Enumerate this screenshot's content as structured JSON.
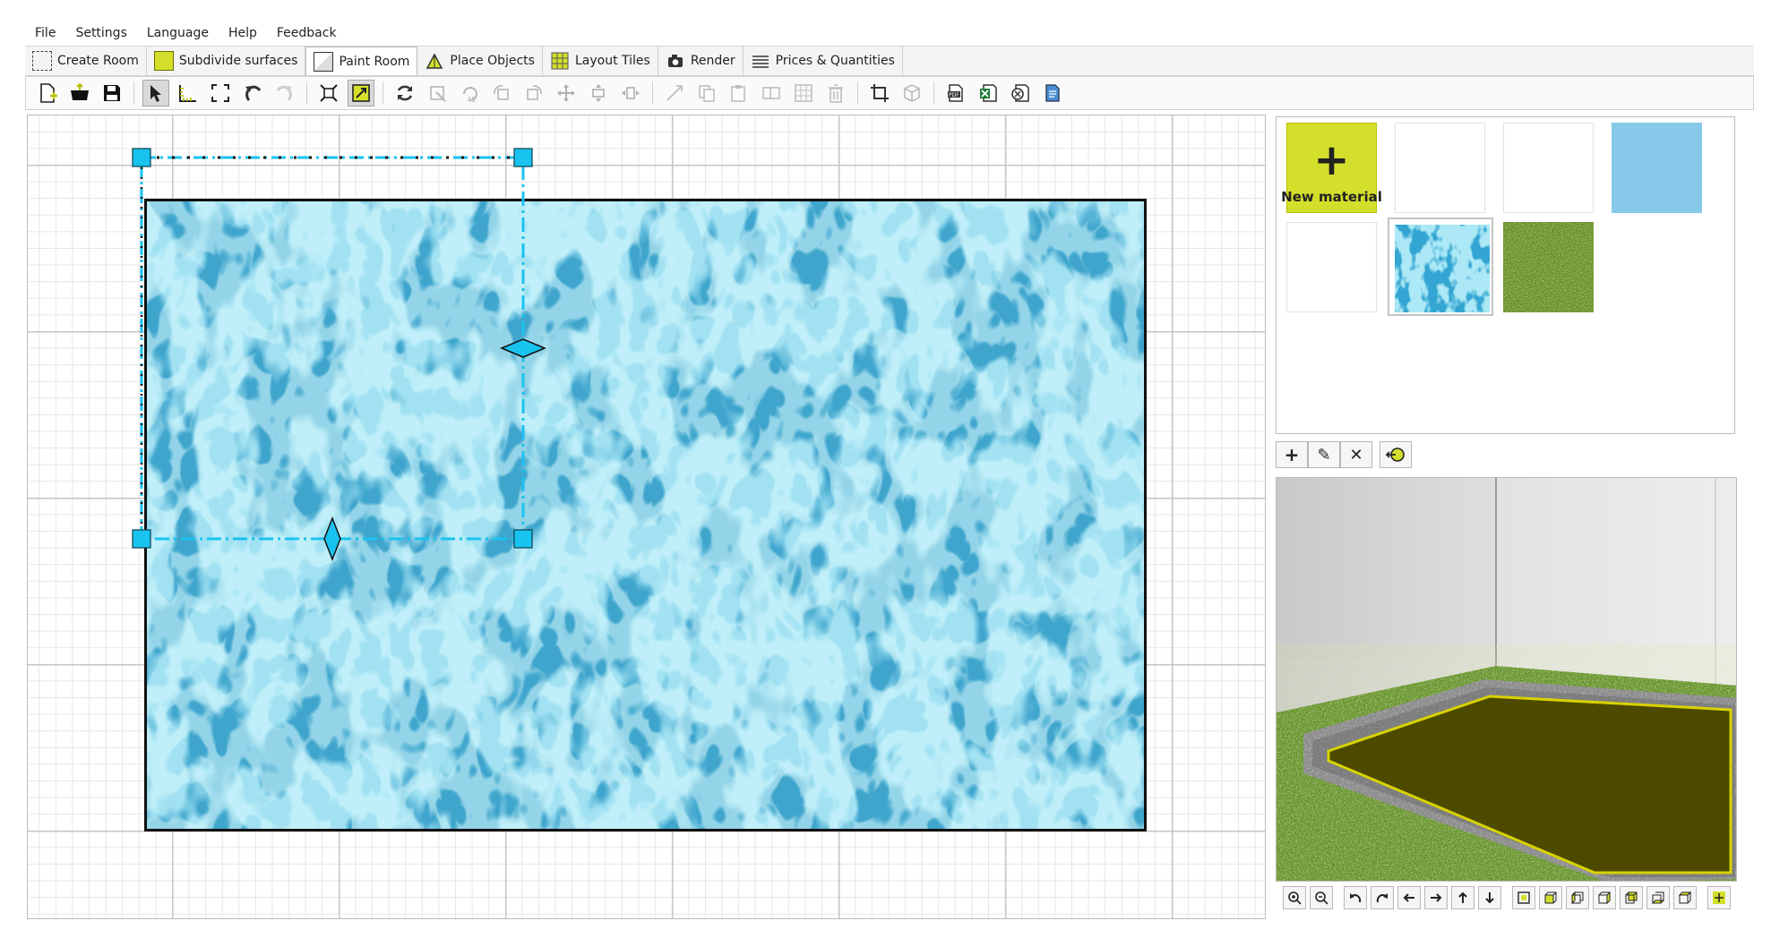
{
  "menu": {
    "file": "File",
    "settings": "Settings",
    "language": "Language",
    "help": "Help",
    "feedback": "Feedback"
  },
  "modes": {
    "create_room": "Create Room",
    "subdivide": "Subdivide surfaces",
    "paint_room": "Paint Room",
    "place_objects": "Place Objects",
    "layout_tiles": "Layout Tiles",
    "render": "Render",
    "prices": "Prices & Quantities"
  },
  "materials": {
    "new_material_label": "New material",
    "plus_glyph": "+",
    "colors": {
      "new_material": "#d4df2b",
      "light_blue": "#86c9e8",
      "water": "#3fb0d9",
      "grass": "#6f9a2a"
    }
  },
  "material_buttons": {
    "add": "+",
    "edit": "✎",
    "delete": "✕",
    "apply": "⮌"
  },
  "accent_colors": {
    "selection": "#19c3f0",
    "room_outline": "#111111",
    "floor_3d": "#4d4a00"
  }
}
